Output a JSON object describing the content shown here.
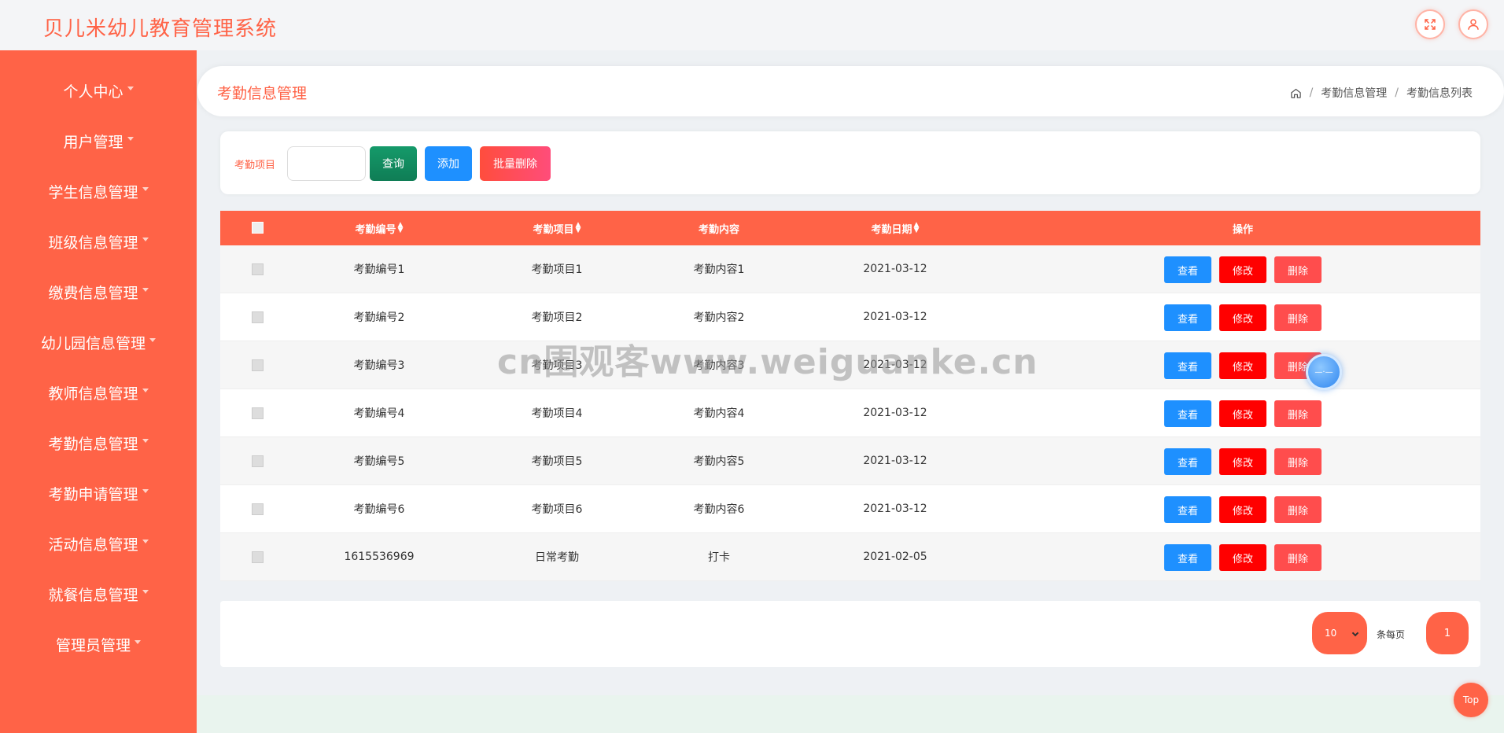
{
  "app": {
    "title": "贝儿米幼儿教育管理系统"
  },
  "header_icons": [
    "fullscreen-icon",
    "user-icon"
  ],
  "sidebar": {
    "items": [
      {
        "label": "个人中心"
      },
      {
        "label": "用户管理"
      },
      {
        "label": "学生信息管理"
      },
      {
        "label": "班级信息管理"
      },
      {
        "label": "缴费信息管理"
      },
      {
        "label": "幼儿园信息管理"
      },
      {
        "label": "教师信息管理"
      },
      {
        "label": "考勤信息管理"
      },
      {
        "label": "考勤申请管理"
      },
      {
        "label": "活动信息管理"
      },
      {
        "label": "就餐信息管理"
      },
      {
        "label": "管理员管理"
      }
    ]
  },
  "page": {
    "title": "考勤信息管理",
    "breadcrumb": [
      "考勤信息管理",
      "考勤信息列表"
    ]
  },
  "search": {
    "label": "考勤项目",
    "value": "",
    "placeholder": "",
    "query_label": "查询",
    "add_label": "添加",
    "batch_delete_label": "批量删除"
  },
  "table": {
    "headers": [
      "考勤编号",
      "考勤项目",
      "考勤内容",
      "考勤日期",
      "操作"
    ],
    "rows": [
      {
        "code": "考勤编号1",
        "item": "考勤项目1",
        "content": "考勤内容1",
        "date": "2021-03-12"
      },
      {
        "code": "考勤编号2",
        "item": "考勤项目2",
        "content": "考勤内容2",
        "date": "2021-03-12"
      },
      {
        "code": "考勤编号3",
        "item": "考勤项目3",
        "content": "考勤内容3",
        "date": "2021-03-12"
      },
      {
        "code": "考勤编号4",
        "item": "考勤项目4",
        "content": "考勤内容4",
        "date": "2021-03-12"
      },
      {
        "code": "考勤编号5",
        "item": "考勤项目5",
        "content": "考勤内容5",
        "date": "2021-03-12"
      },
      {
        "code": "考勤编号6",
        "item": "考勤项目6",
        "content": "考勤内容6",
        "date": "2021-03-12"
      },
      {
        "code": "1615536969",
        "item": "日常考勤",
        "content": "打卡",
        "date": "2021-02-05"
      }
    ],
    "actions": {
      "view": "查看",
      "edit": "修改",
      "delete": "删除"
    }
  },
  "pager": {
    "page_size": "10",
    "per_page_label": "条每页",
    "current_page": "1"
  },
  "watermark": "cn围观客www.weiguanke.cn",
  "top_button": "Top",
  "colors": {
    "accent": "#ff6347",
    "blue": "#1e90ff",
    "red": "#ff0000",
    "green": "#159a6a"
  }
}
